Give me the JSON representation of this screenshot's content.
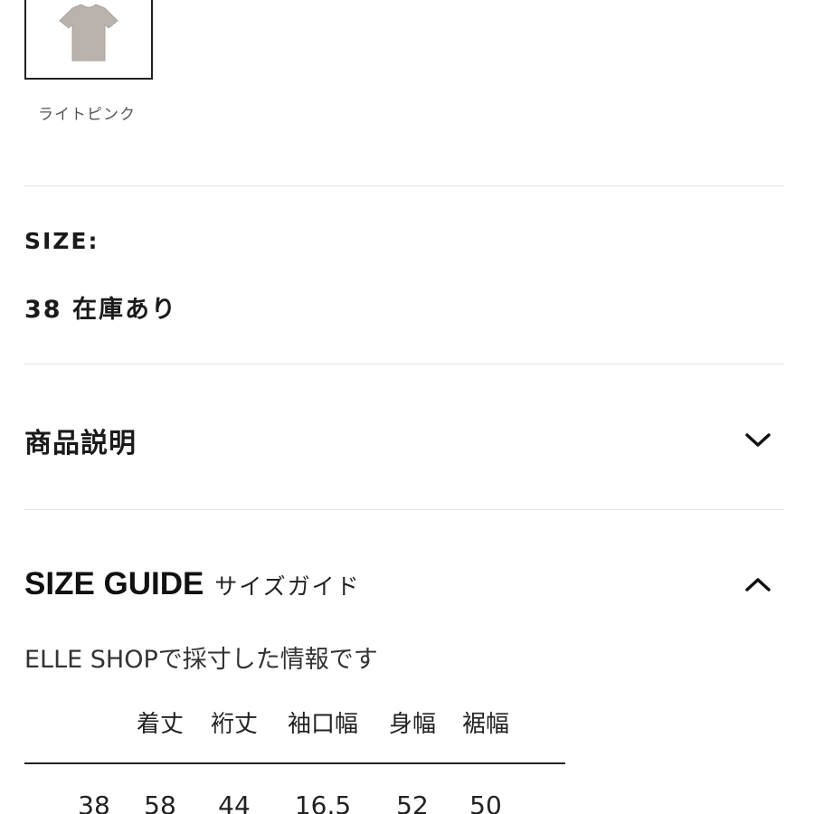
{
  "color": {
    "swatch_label": "ライトピンク",
    "swatch_color": "#b9b2ad"
  },
  "size": {
    "heading": "SIZE:",
    "value": "38 在庫あり"
  },
  "product_description": {
    "title": "商品説明",
    "icon": "chevron-down-icon",
    "expanded": false
  },
  "size_guide": {
    "title": "SIZE GUIDE",
    "subtitle": "サイズガイド",
    "icon": "chevron-up-icon",
    "expanded": true,
    "note": "ELLE SHOPで採寸した情報です",
    "columns": [
      "着丈",
      "裄丈",
      "袖口幅",
      "身幅",
      "裾幅"
    ],
    "rows": [
      {
        "size": "38",
        "values": [
          "58",
          "44",
          "16.5",
          "52",
          "50"
        ]
      }
    ]
  }
}
